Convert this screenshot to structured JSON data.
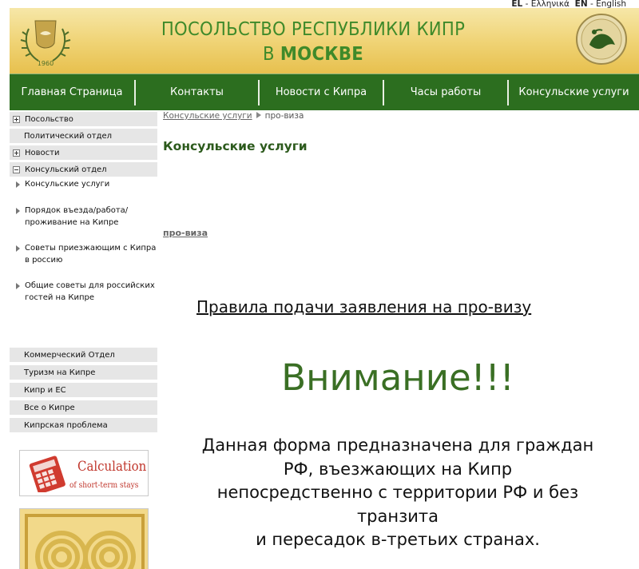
{
  "lang": {
    "el_code": "EL",
    "el_label": "Ελληνικά",
    "en_code": "EN",
    "en_label": "English"
  },
  "header": {
    "title_line1": "ПОСОЛЬСТВО РЕСПУБЛИКИ КИПР",
    "title_line2_prefix": "В ",
    "title_line2_bold": "МОСКВЕ",
    "title_color": "#3f8a2a",
    "banner_color": "#f0d477"
  },
  "nav": {
    "items": [
      "Главная Страница",
      "Контакты",
      "Новости с Кипра",
      "Часы работы",
      "Консульские услуги"
    ],
    "bg_color": "#2c6e1f"
  },
  "sidebar": {
    "top_items": [
      {
        "label": "Посольство",
        "toggle": "plus"
      },
      {
        "label": "Политический отдел",
        "toggle": "none"
      },
      {
        "label": "Новости",
        "toggle": "plus"
      },
      {
        "label": "Консульский отдел",
        "toggle": "minus"
      }
    ],
    "sub_items": [
      "Консульские услуги",
      "Порядок въезда/работа/проживание на Кипре",
      "Советы приезжающим с Кипра в россию",
      "Общие советы для российских гостей на Кипре"
    ],
    "bottom_items": [
      "Коммерческий Отдел",
      "Туризм на Кипре",
      "Кипр и ЕС",
      "Все о Кипре",
      "Кипрская проблема"
    ],
    "promo": {
      "line1": "Calculation",
      "line2": "of short-term stays"
    }
  },
  "main": {
    "breadcrumb": {
      "link": "Консульские услуги",
      "current": "про-виза"
    },
    "title": "Консульские услуги",
    "sub_link": "про-виза",
    "rules_link": "Правила подачи заявления на про-визу",
    "attention": "Внимание!!!",
    "notice_lines": [
      "Данная форма предназначена для граждан",
      "РФ, въезжающих на Кипр",
      "непосредственно с территории РФ и без",
      "транзита",
      "и пересадок в-третьих странах."
    ],
    "accent_color": "#3a6f24"
  }
}
